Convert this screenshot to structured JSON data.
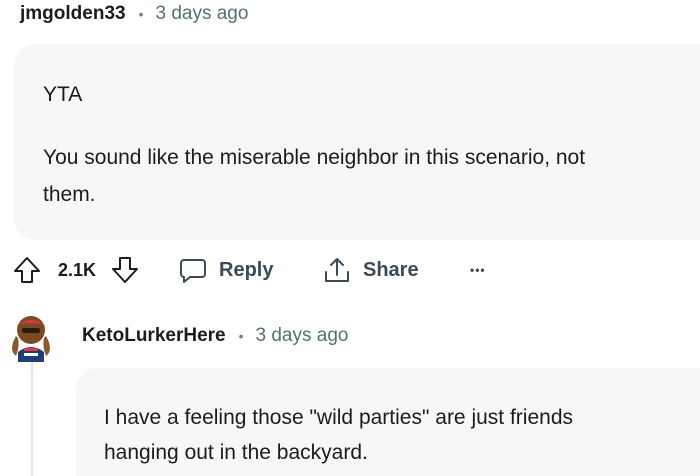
{
  "comment": {
    "username": "jmgolden33",
    "separator": "•",
    "timestamp": "3 days ago",
    "paragraphs": [
      "YTA",
      "You sound like the miserable neighbor in this scenario, not",
      "them."
    ]
  },
  "actions": {
    "upvote_icon": "upvote-arrow-icon",
    "vote_count": "2.1K",
    "downvote_icon": "downvote-arrow-icon",
    "reply_label": "Reply",
    "share_label": "Share",
    "more_label": "•••"
  },
  "reply": {
    "username": "KetoLurkerHere",
    "separator": "•",
    "timestamp": "3 days ago",
    "lines": [
      "I have a feeling those \"wild parties\" are just friends",
      "hanging out in the backyard."
    ]
  },
  "colors": {
    "bubble_bg": "#f6f7f8",
    "meta_gray": "#576f76",
    "action_gray": "#3b4a54"
  }
}
